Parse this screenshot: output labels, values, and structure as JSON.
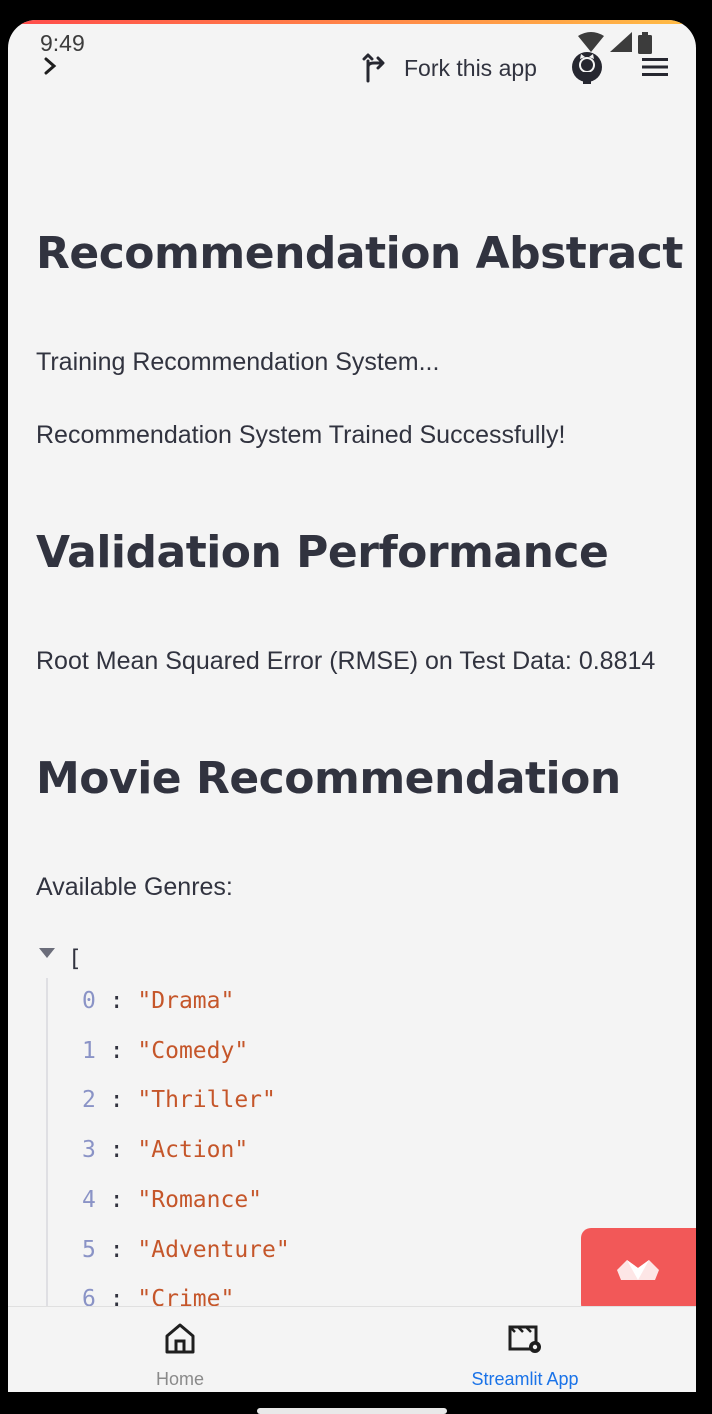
{
  "status_bar": {
    "time": "9:49"
  },
  "header": {
    "fork_label": "Fork this app"
  },
  "main": {
    "heading_abstract": "Recommendation Abstract",
    "text_training": "Training Recommendation System...",
    "text_trained": "Recommendation System Trained Successfully!",
    "heading_validation": "Validation Performance",
    "text_rmse": "Root Mean Squared Error (RMSE) on Test Data: 0.8814",
    "heading_movie": "Movie Recommendation",
    "text_genres": "Available Genres:"
  },
  "genres_json": {
    "open_bracket": "[",
    "items": [
      {
        "index": "0",
        "value": "\"Drama\""
      },
      {
        "index": "1",
        "value": "\"Comedy\""
      },
      {
        "index": "2",
        "value": "\"Thriller\""
      },
      {
        "index": "3",
        "value": "\"Action\""
      },
      {
        "index": "4",
        "value": "\"Romance\""
      },
      {
        "index": "5",
        "value": "\"Adventure\""
      },
      {
        "index": "6",
        "value": "\"Crime\""
      }
    ]
  },
  "bottom_nav": {
    "home_label": "Home",
    "app_label": "Streamlit App",
    "active_color": "#1a73e8",
    "inactive_color": "#8a8a8a"
  },
  "colors": {
    "accent": "#f25858",
    "text": "#31333f",
    "json_index": "#8a93c6",
    "json_string": "#c5562a"
  }
}
